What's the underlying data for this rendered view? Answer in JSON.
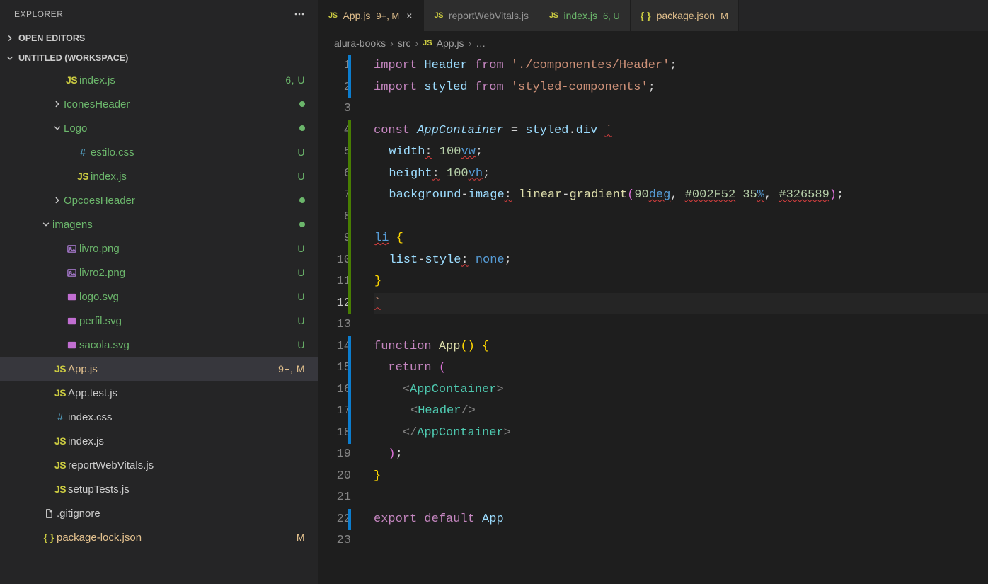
{
  "sidebar": {
    "title": "EXPLORER",
    "openEditors": "OPEN EDITORS",
    "workspace": "UNTITLED (WORKSPACE)"
  },
  "tree": [
    {
      "depth": 3,
      "type": "file",
      "icon": "js",
      "label": "index.js",
      "git": "unt",
      "status": "6, U"
    },
    {
      "depth": 3,
      "type": "folder",
      "twisty": "right",
      "label": "IconesHeader",
      "git": "unt",
      "dot": true
    },
    {
      "depth": 3,
      "type": "folder",
      "twisty": "down",
      "label": "Logo",
      "git": "unt",
      "dot": true
    },
    {
      "depth": 4,
      "type": "file",
      "icon": "css",
      "label": "estilo.css",
      "git": "unt",
      "status": "U"
    },
    {
      "depth": 4,
      "type": "file",
      "icon": "js",
      "label": "index.js",
      "git": "unt",
      "status": "U"
    },
    {
      "depth": 3,
      "type": "folder",
      "twisty": "right",
      "label": "OpcoesHeader",
      "git": "unt",
      "dot": true
    },
    {
      "depth": 2,
      "type": "folder",
      "twisty": "down",
      "label": "imagens",
      "git": "unt",
      "dot": true
    },
    {
      "depth": 3,
      "type": "file",
      "icon": "img",
      "label": "livro.png",
      "git": "unt",
      "status": "U"
    },
    {
      "depth": 3,
      "type": "file",
      "icon": "img",
      "label": "livro2.png",
      "git": "unt",
      "status": "U"
    },
    {
      "depth": 3,
      "type": "file",
      "icon": "svg",
      "label": "logo.svg",
      "git": "unt",
      "status": "U"
    },
    {
      "depth": 3,
      "type": "file",
      "icon": "svg",
      "label": "perfil.svg",
      "git": "unt",
      "status": "U"
    },
    {
      "depth": 3,
      "type": "file",
      "icon": "svg",
      "label": "sacola.svg",
      "git": "unt",
      "status": "U"
    },
    {
      "depth": 2,
      "type": "file",
      "icon": "js",
      "label": "App.js",
      "git": "mod",
      "status": "9+, M",
      "active": true
    },
    {
      "depth": 2,
      "type": "file",
      "icon": "js",
      "label": "App.test.js"
    },
    {
      "depth": 2,
      "type": "file",
      "icon": "css",
      "label": "index.css"
    },
    {
      "depth": 2,
      "type": "file",
      "icon": "js",
      "label": "index.js"
    },
    {
      "depth": 2,
      "type": "file",
      "icon": "js",
      "label": "reportWebVitals.js"
    },
    {
      "depth": 2,
      "type": "file",
      "icon": "js",
      "label": "setupTests.js"
    },
    {
      "depth": 1,
      "type": "file",
      "icon": "file",
      "label": ".gitignore"
    },
    {
      "depth": 1,
      "type": "file",
      "icon": "json",
      "label": "package-lock.json",
      "git": "mod",
      "status": "M"
    }
  ],
  "tabs": [
    {
      "icon": "js",
      "label": "App.js",
      "status": "9+, M",
      "git": "mod",
      "active": true,
      "close": true
    },
    {
      "icon": "js",
      "label": "reportWebVitals.js"
    },
    {
      "icon": "js",
      "label": "index.js",
      "status": "6, U",
      "git": "unt"
    },
    {
      "icon": "json",
      "label": "package.json",
      "status": "M",
      "git": "mod"
    }
  ],
  "breadcrumb": {
    "parts": [
      "alura-books",
      "src"
    ],
    "fileIcon": "js",
    "file": "App.js",
    "tail": "…"
  },
  "editor": {
    "currentLine": 12,
    "lines": [
      {
        "n": 1,
        "mod": "mod",
        "html": "<span class='tk-kw'>import</span> <span class='tk-id'>Header</span> <span class='tk-kw'>from</span> <span class='tk-str'>'./componentes/Header'</span><span class='tk-punc'>;</span>"
      },
      {
        "n": 2,
        "mod": "mod",
        "html": "<span class='tk-kw'>import</span> <span class='tk-id'>styled</span> <span class='tk-kw'>from</span> <span class='tk-str'>'styled-components'</span><span class='tk-punc'>;</span>"
      },
      {
        "n": 3,
        "html": ""
      },
      {
        "n": 4,
        "mod": "add",
        "html": "<span class='tk-kw'>const</span> <span class='tk-var'>AppContainer</span> <span class='tk-op'>=</span> <span class='tk-id'>styled</span><span class='tk-punc'>.</span><span class='tk-id'>div</span> <span class='tk-str mini-sq'>`</span>"
      },
      {
        "n": 5,
        "mod": "add",
        "html": "<span class='indent-guide'></span>  <span class='tk-csskey'>width</span><span class='mini-sq'>:</span> <span class='tk-num'>100</span><span class='tk-cssvalKw mini-sq'>vw</span><span class='tk-punc'>;</span>"
      },
      {
        "n": 6,
        "mod": "add",
        "html": "<span class='indent-guide'></span>  <span class='tk-csskey'>height</span><span class='mini-sq'>:</span> <span class='tk-num'>100</span><span class='tk-cssvalKw mini-sq'>vh</span><span class='tk-punc'>;</span>"
      },
      {
        "n": 7,
        "mod": "add",
        "html": "<span class='indent-guide'></span>  <span class='tk-csskey'>background</span>-<span class='tk-csskey'>image</span><span class='mini-sq'>:</span> <span class='tk-fn'>linear</span>-<span class='tk-fn'>gradient</span><span class='tk-bracP'>(</span><span class='tk-num'>90</span><span class='tk-cssvalKw mini-sq'>deg</span><span class='tk-punc'>,</span> <span class='tk-num mini-sq'>#002F52</span> <span class='tk-num'>35</span><span class='tk-cssvalKw mini-sq'>%</span><span class='tk-punc'>,</span> <span class='tk-num mini-sq'>#326589</span><span class='tk-bracP'>)</span><span class='tk-punc'>;</span>"
      },
      {
        "n": 8,
        "mod": "add",
        "html": "<span class='indent-guide'></span>"
      },
      {
        "n": 9,
        "mod": "add",
        "html": "<span class='indent-guide'></span><span class='tk-cssvalKw mini-sq'>li</span> <span class='tk-brace'>{</span>"
      },
      {
        "n": 10,
        "mod": "add",
        "html": "<span class='indent-guide'></span>  <span class='tk-csskey'>list</span>-<span class='tk-csskey'>style</span><span class='mini-sq'>:</span> <span class='tk-cssvalKw'>none</span><span class='tk-punc'>;</span>"
      },
      {
        "n": 11,
        "mod": "add",
        "html": "<span class='indent-guide'></span><span class='tk-brace'>}</span>"
      },
      {
        "n": 12,
        "mod": "add",
        "hl": true,
        "html": "<span class='tk-str mini-sq'>`</span><span class='cursor'></span>"
      },
      {
        "n": 13,
        "html": ""
      },
      {
        "n": 14,
        "mod": "mod",
        "html": "<span class='tk-kw'>function</span> <span class='tk-fn'>App</span><span class='tk-brace'>(</span><span class='tk-brace'>)</span> <span class='tk-brace'>{</span>"
      },
      {
        "n": 15,
        "mod": "mod",
        "html": "  <span class='tk-kw'>return</span> <span class='tk-bracP'>(</span>"
      },
      {
        "n": 16,
        "mod": "mod",
        "html": "    <span class='tk-angle'>&lt;</span><span class='tk-tag'>AppContainer</span><span class='tk-angle'>&gt;</span>"
      },
      {
        "n": 17,
        "mod": "mod",
        "html": "    <span class='indent-guide'></span> <span class='tk-angle'>&lt;</span><span class='tk-tag'>Header</span><span class='tk-angle'>/&gt;</span>"
      },
      {
        "n": 18,
        "mod": "mod",
        "html": "    <span class='tk-angle'>&lt;/</span><span class='tk-tag'>AppContainer</span><span class='tk-angle'>&gt;</span>"
      },
      {
        "n": 19,
        "html": "  <span class='tk-bracP'>)</span><span class='tk-punc'>;</span>"
      },
      {
        "n": 20,
        "html": "<span class='tk-brace'>}</span>"
      },
      {
        "n": 21,
        "html": ""
      },
      {
        "n": 22,
        "mod": "mod",
        "html": "<span class='tk-kw'>export</span> <span class='tk-kw'>default</span> <span class='tk-id'>App</span>"
      },
      {
        "n": 23,
        "html": ""
      }
    ]
  }
}
